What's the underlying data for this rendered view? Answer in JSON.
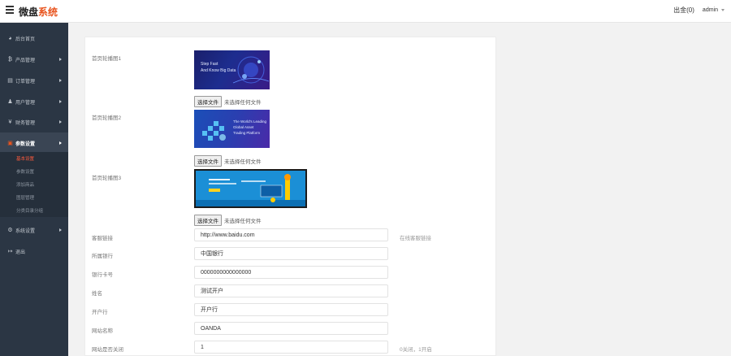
{
  "header": {
    "logo_main": "微盘",
    "logo_accent": "系统",
    "messages": "出金(0)",
    "user": "admin"
  },
  "sidebar": {
    "items": [
      {
        "label": "后台首页",
        "icon": "dashboard-icon"
      },
      {
        "label": "产品管理",
        "icon": "bitcoin-icon"
      },
      {
        "label": "订单管理",
        "icon": "orders-icon"
      },
      {
        "label": "用户管理",
        "icon": "user-icon"
      },
      {
        "label": "财务管理",
        "icon": "yen-icon"
      },
      {
        "label": "参数设置",
        "icon": "settings-icon"
      },
      {
        "label": "系统设置",
        "icon": "gear-icon"
      },
      {
        "label": "退出",
        "icon": "logout-icon"
      }
    ],
    "sub_items": [
      "基本设置",
      "参数设置",
      "添加商品",
      "图层管理",
      "分类目录分组"
    ]
  },
  "form": {
    "carousel1_label": "首页轮播图1",
    "carousel2_label": "首页轮播图2",
    "carousel3_label": "首页轮播图3",
    "banner1": {
      "line1": "Step Fast",
      "line2": "And Know Big Data"
    },
    "banner2": {
      "line1": "The World's Leading",
      "line2": "Global Asset",
      "line3": "Trading Platform"
    },
    "file_button": "选择文件",
    "file_none": "未选择任何文件",
    "rows": [
      {
        "label": "客服链接",
        "value": "http://www.baidu.com",
        "hint": "在线客服链接"
      },
      {
        "label": "所属银行",
        "value": "中国银行",
        "hint": ""
      },
      {
        "label": "银行卡号",
        "value": "0000000000000000",
        "hint": ""
      },
      {
        "label": "姓名",
        "value": "测试开户",
        "hint": ""
      },
      {
        "label": "开户行",
        "value": "开户行",
        "hint": ""
      },
      {
        "label": "网站名称",
        "value": "OANDA",
        "hint": ""
      },
      {
        "label": "网站是否关闭",
        "value": "1",
        "hint": "0关闭，1开启"
      }
    ]
  },
  "colors": {
    "sidebar_bg": "#2b3644",
    "accent": "#e8541e",
    "active_sub": "#ff5a3c"
  }
}
